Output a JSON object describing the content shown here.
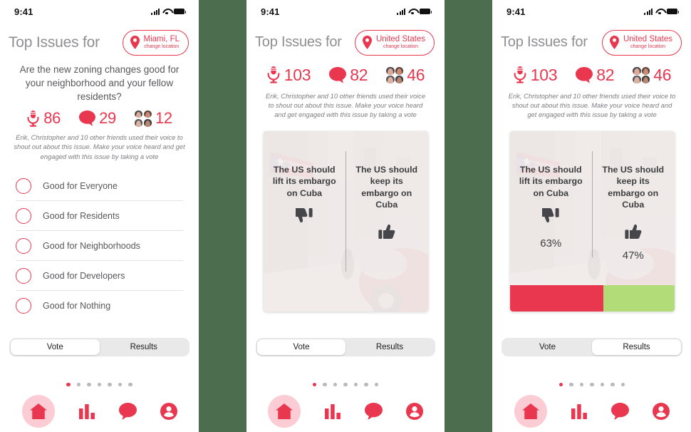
{
  "brand": {
    "accent": "#e8374f",
    "accent_soft": "#fbccd4",
    "bar_negative": "#e8374f",
    "bar_positive": "#b2dc78",
    "backdrop": "#4c6e4e"
  },
  "status_bar": {
    "time": "9:41",
    "signal_icon": "cellular-signal-icon",
    "wifi_icon": "wifi-icon",
    "battery_icon": "battery-icon"
  },
  "header": {
    "title": "Top Issues for",
    "location_pin_icon": "map-pin-icon",
    "change_location_label": "change location"
  },
  "screens": [
    {
      "id": "vote-list",
      "location": "Miami, FL",
      "question": "Are the new zoning changes good for your neighborhood and your fellow residents?",
      "stats": [
        {
          "icon": "microphone-icon",
          "value": "86"
        },
        {
          "icon": "comment-bubble-icon",
          "value": "29"
        },
        {
          "icon": "friends-avatars-icon",
          "value": "12"
        }
      ],
      "friends_note": "Erik, Christopher and 10 other friends used their voice to shout out about this issue. Make your voice heard and get engaged with this issue by taking a vote",
      "options": [
        "Good for Everyone",
        "Good for Residents",
        "Good for Neighborhoods",
        "Good for Developers",
        "Good for Nothing"
      ],
      "segmented": {
        "items": [
          "Vote",
          "Results"
        ],
        "selected": "Vote"
      },
      "dots": {
        "count": 7,
        "active_index": 0
      }
    },
    {
      "id": "vote-card",
      "location": "United States",
      "stats": [
        {
          "icon": "microphone-icon",
          "value": "103"
        },
        {
          "icon": "comment-bubble-icon",
          "value": "82"
        },
        {
          "icon": "friends-avatars-icon",
          "value": "46"
        }
      ],
      "friends_note": "Erik, Christopher and 10 other friends used their voice to shout out about this issue. Make your voice heard and get engaged with this issue by taking a vote",
      "card": {
        "left": {
          "text": "The US should lift its embargo on Cuba",
          "icon": "thumbs-down-icon",
          "percent": ""
        },
        "right": {
          "text": "The US should keep its embargo on Cuba",
          "icon": "thumbs-up-icon",
          "percent": ""
        },
        "show_results": false
      },
      "segmented": {
        "items": [
          "Vote",
          "Results"
        ],
        "selected": "Vote"
      },
      "dots": {
        "count": 7,
        "active_index": 0
      }
    },
    {
      "id": "results-card",
      "location": "United States",
      "stats": [
        {
          "icon": "microphone-icon",
          "value": "103"
        },
        {
          "icon": "comment-bubble-icon",
          "value": "82"
        },
        {
          "icon": "friends-avatars-icon",
          "value": "46"
        }
      ],
      "friends_note": "Erik, Christopher and 10 other friends used their voice to shout out about this issue. Make your voice heard and get engaged with this issue by taking a vote",
      "card": {
        "left": {
          "text": "The US should lift its embargo on Cuba",
          "icon": "thumbs-down-icon",
          "percent": "63%"
        },
        "right": {
          "text": "The US should keep its embargo on Cuba",
          "icon": "thumbs-up-icon",
          "percent": "47%"
        },
        "show_results": true
      },
      "segmented": {
        "items": [
          "Vote",
          "Results"
        ],
        "selected": "Results"
      },
      "dots": {
        "count": 7,
        "active_index": 0
      }
    }
  ],
  "tabbar": {
    "items": [
      {
        "icon": "home-icon",
        "active": true
      },
      {
        "icon": "bar-chart-icon",
        "active": false
      },
      {
        "icon": "chat-bubble-icon",
        "active": false
      },
      {
        "icon": "profile-icon",
        "active": false
      }
    ]
  }
}
